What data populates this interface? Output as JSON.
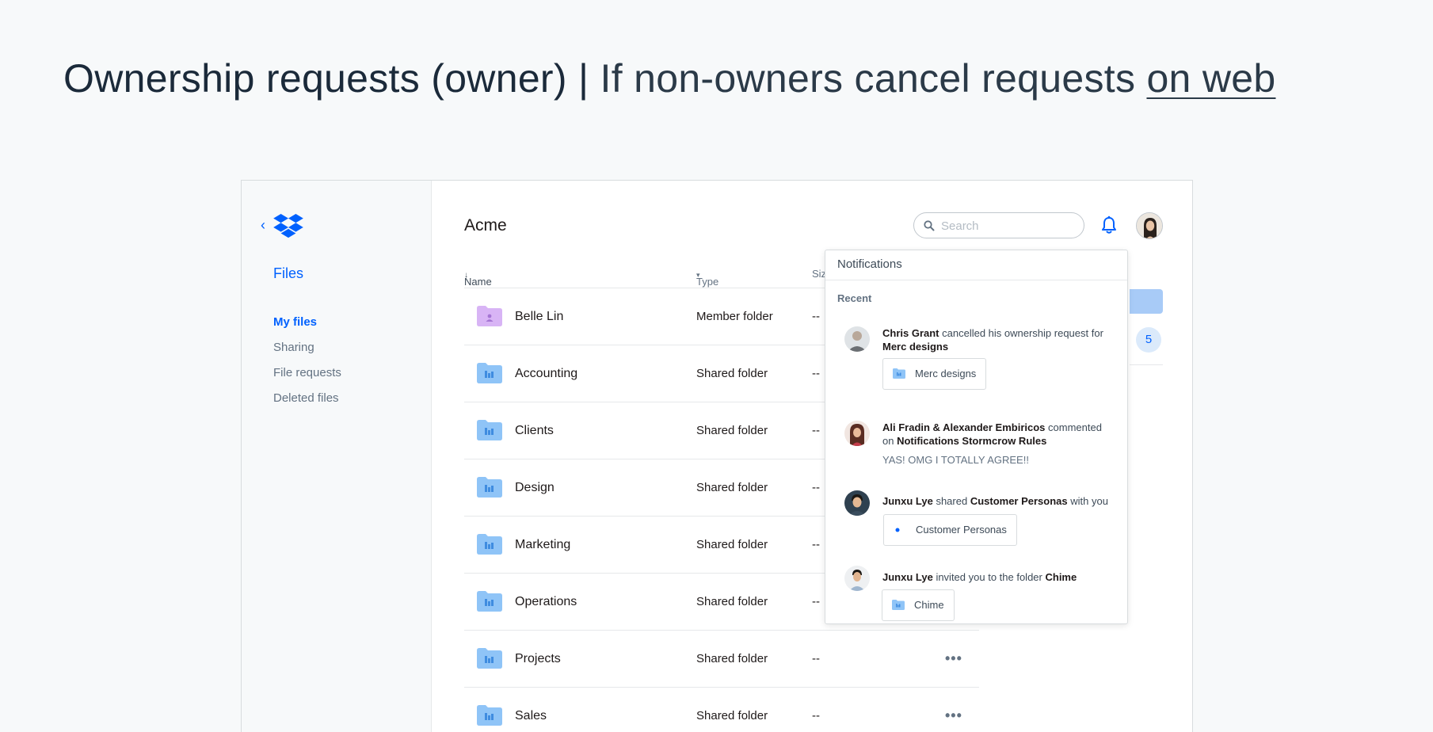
{
  "heading": {
    "main": "Ownership requests (owner)",
    "separator": "|",
    "sub_prefix": "If non-owners cancel requests",
    "sub_link": "on web"
  },
  "sidebar": {
    "section": "Files",
    "items": [
      {
        "label": "My files",
        "active": true
      },
      {
        "label": "Sharing"
      },
      {
        "label": "File requests"
      },
      {
        "label": "Deleted files"
      }
    ]
  },
  "header": {
    "breadcrumb": "Acme",
    "search_placeholder": "Search"
  },
  "table": {
    "columns": {
      "name": "Name",
      "type": "Type",
      "size": "Siz"
    },
    "rows": [
      {
        "name": "Belle Lin",
        "type": "Member folder",
        "size": "--",
        "kind": "member"
      },
      {
        "name": "Accounting",
        "type": "Shared folder",
        "size": "--",
        "kind": "shared"
      },
      {
        "name": "Clients",
        "type": "Shared folder",
        "size": "--",
        "kind": "shared"
      },
      {
        "name": "Design",
        "type": "Shared folder",
        "size": "--",
        "kind": "shared"
      },
      {
        "name": "Marketing",
        "type": "Shared folder",
        "size": "--",
        "kind": "shared"
      },
      {
        "name": "Operations",
        "type": "Shared folder",
        "size": "--",
        "kind": "shared"
      },
      {
        "name": "Projects",
        "type": "Shared folder",
        "size": "--",
        "kind": "shared",
        "more": "•••"
      },
      {
        "name": "Sales",
        "type": "Shared folder",
        "size": "--",
        "kind": "shared",
        "more": "•••"
      }
    ]
  },
  "right_panel": {
    "count": "5"
  },
  "notifications": {
    "title": "Notifications",
    "section": "Recent",
    "items": [
      {
        "actor": "Chris Grant",
        "action": " cancelled his ownership request for ",
        "object": "Merc designs",
        "chip": "Merc designs"
      },
      {
        "actor": "Ali Fradin & Alexander Embiricos",
        "action": " commented on ",
        "object": "Notifications Stormcrow Rules",
        "quote": "YAS! OMG I TOTALLY AGREE!!"
      },
      {
        "actor": "Junxu Lye",
        "action": " shared ",
        "object": "Customer Personas",
        "suffix": " with you",
        "chip": "Customer Personas"
      },
      {
        "actor": "Junxu Lye",
        "action": " invited you to the folder ",
        "object": "Chime",
        "chip": "Chime"
      }
    ]
  },
  "colors": {
    "accent": "#0061fe",
    "shared_folder": "#8fc4f7",
    "member_folder": "#d8b4f5"
  }
}
